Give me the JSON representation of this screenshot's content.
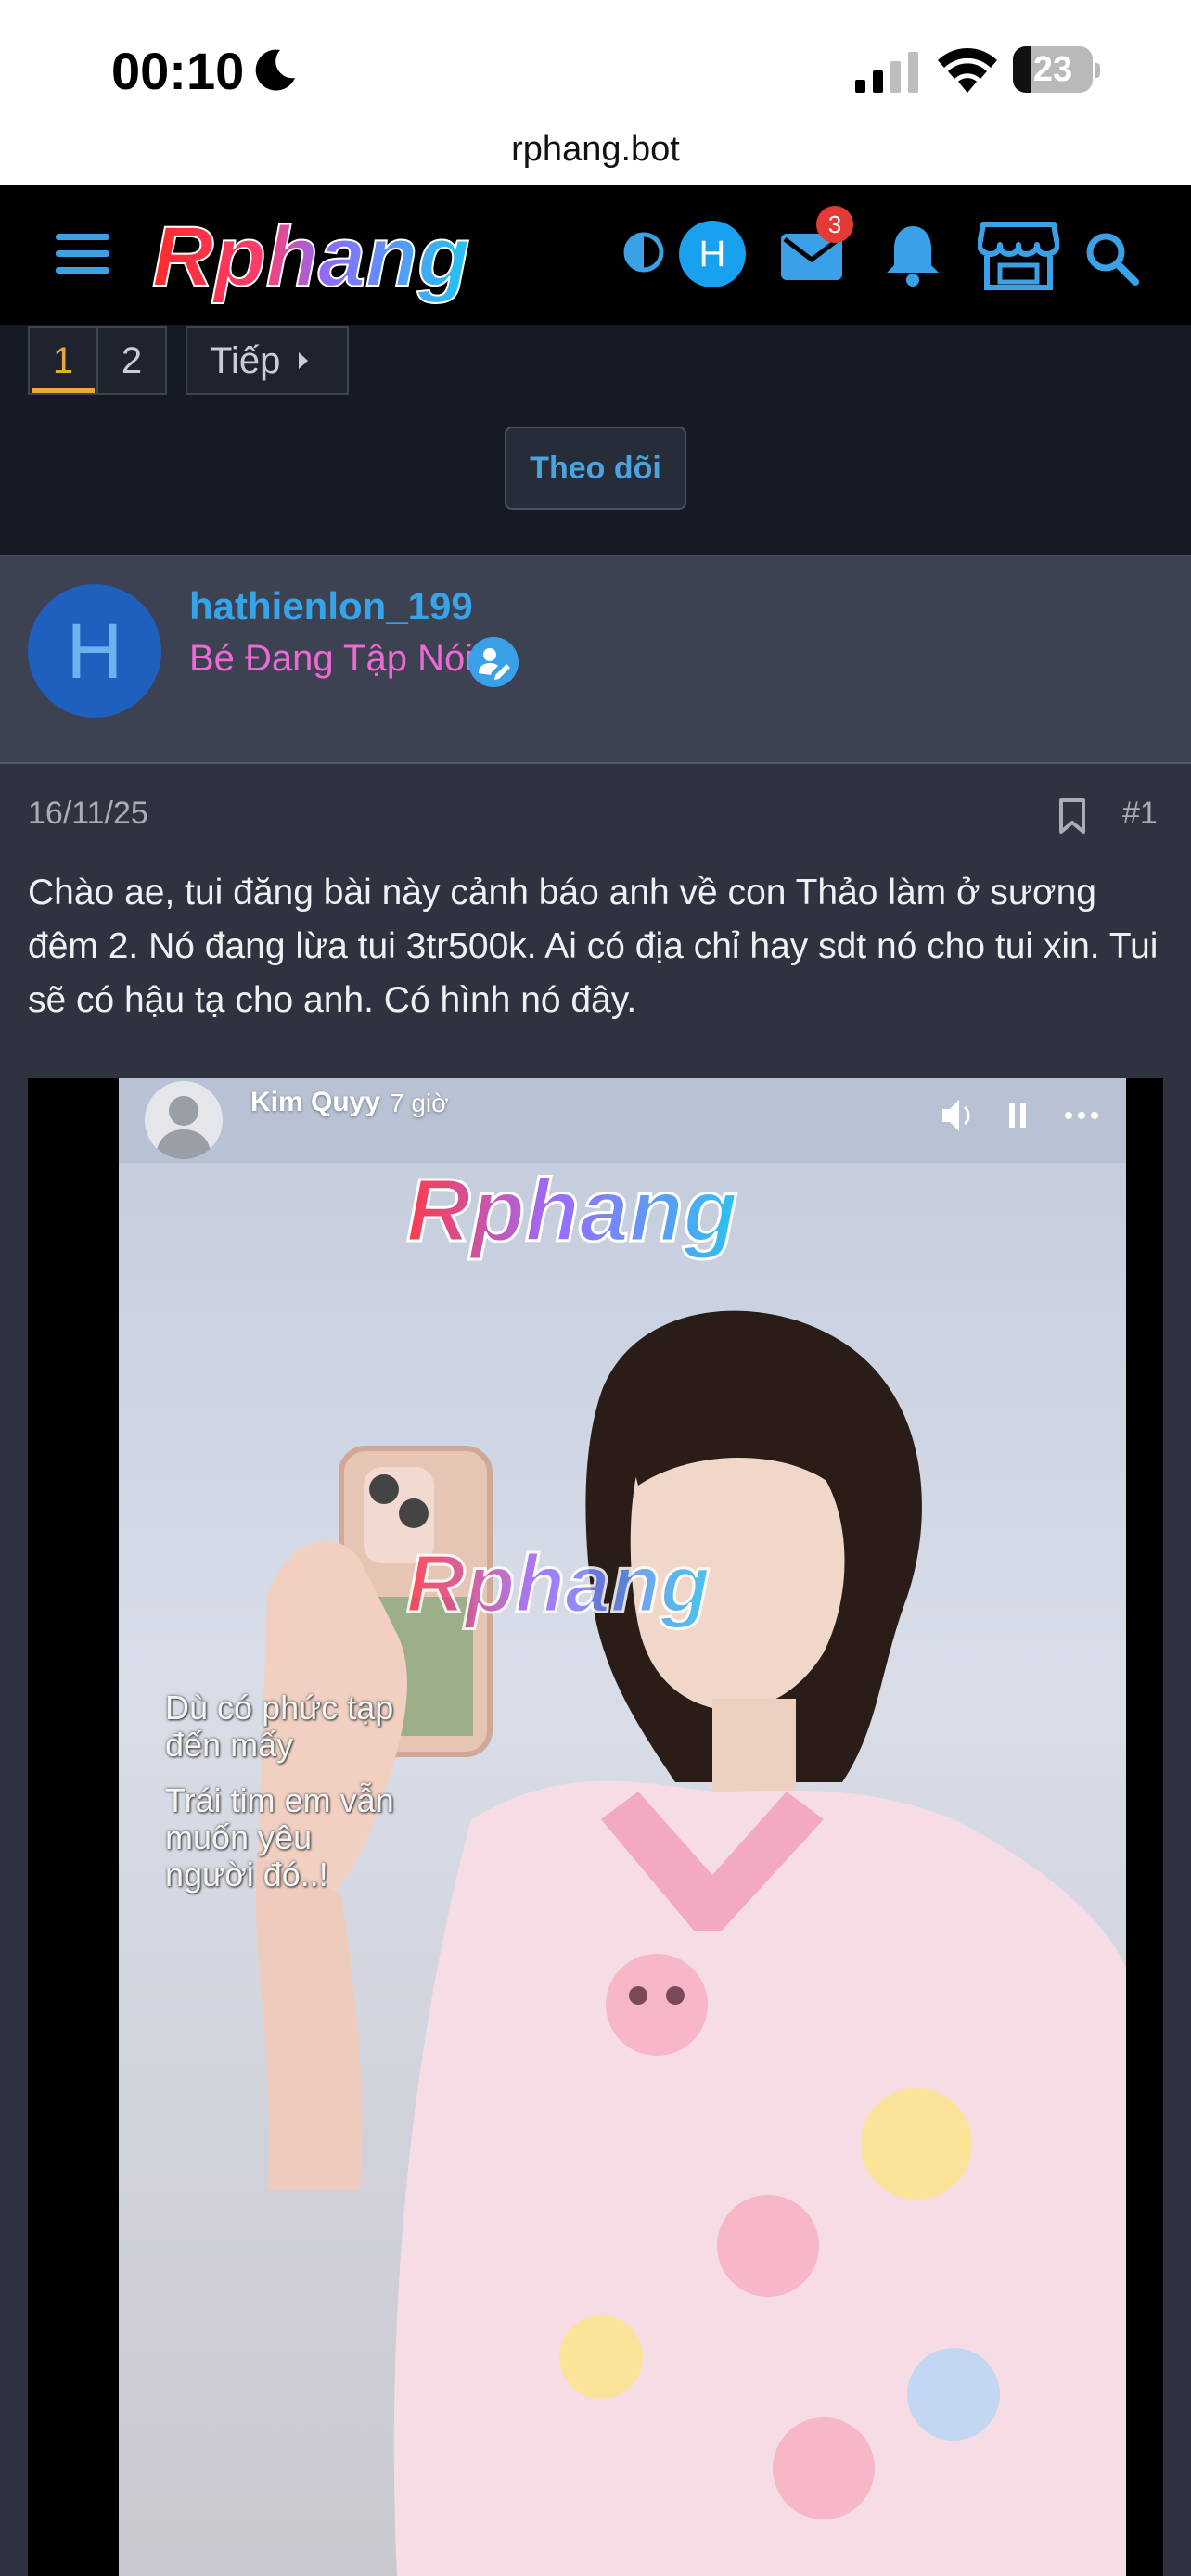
{
  "status_bar": {
    "time": "00:10",
    "battery": "23",
    "battery_level": 0.23
  },
  "browser": {
    "url": "rphang.bot"
  },
  "header": {
    "logo_text": "Rphang",
    "user_initial": "H",
    "mail_badge": "3",
    "accent_color": "#3aa1e9"
  },
  "pagination": {
    "pages": [
      "1",
      "2"
    ],
    "current_page": "1",
    "next_label": "Tiếp",
    "follow_label": "Theo dõi"
  },
  "user": {
    "initial": "H",
    "username": "hathienlon_199",
    "title": "Bé Đang Tập Nói"
  },
  "post": {
    "date": "16/11/25",
    "number": "#1",
    "body": "Chào ae, tui đăng bài này cảnh báo anh về con Thảo làm ở sương đêm 2. Nó đang lừa tui 3tr500k. Ai có địa chỉ hay sdt nó cho tui xin. Tui sẽ có hậu tạ cho anh. Có hình nó đây."
  },
  "image": {
    "fb_name": "Kim Quyy",
    "fb_time": "7 giờ",
    "watermark": "Rphang",
    "caption_1": [
      "Dù có phức tạp",
      "đến mấy"
    ],
    "caption_2": [
      "Trái tim em vẫn",
      "muốn yêu",
      "người đó..!"
    ]
  }
}
